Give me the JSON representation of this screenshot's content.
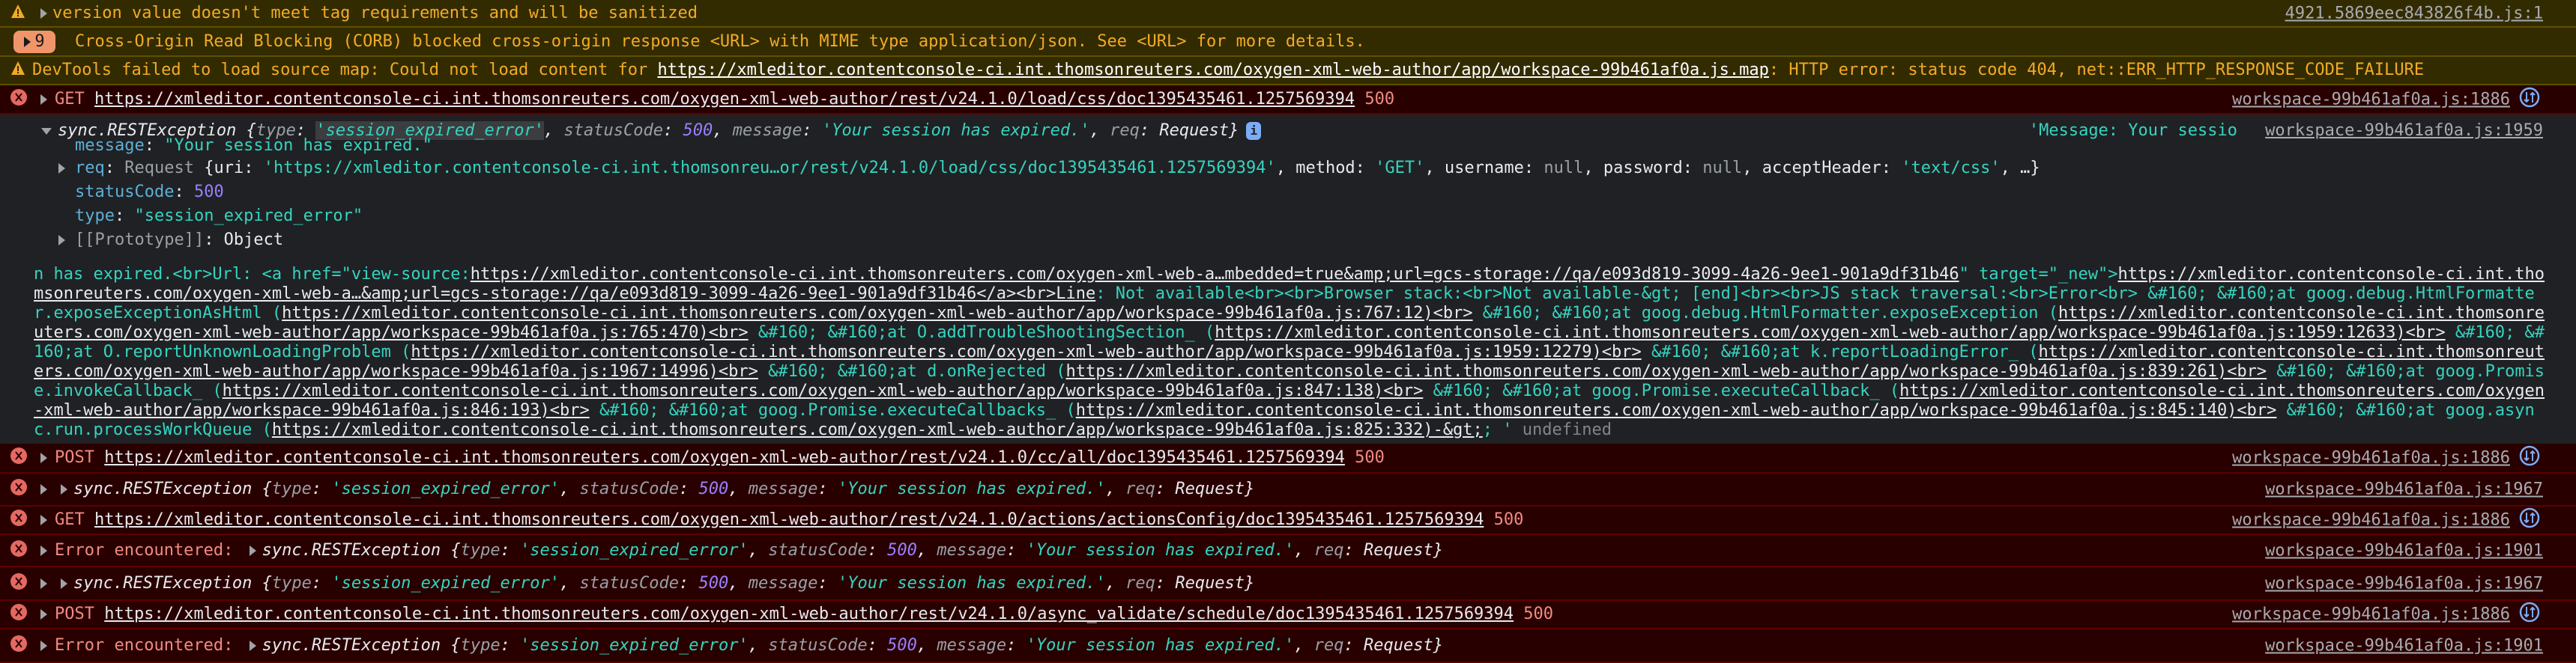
{
  "colors": {
    "warning_bg": "#332b00",
    "warning_text": "#f2ab26",
    "error_bg": "#290000",
    "error_text": "#f28b82",
    "string": "#35d4c0",
    "number": "#9980ff",
    "network_icon": "#7cacf8"
  },
  "rows_top": [
    {
      "level": "warning",
      "icon": "warning-icon",
      "has_toggle": true,
      "segments": [
        {
          "t": "version value doesn't meet tag requirements and will be sanitized"
        }
      ],
      "source": "4921.5869eec843826f4b.js:1"
    },
    {
      "level": "group",
      "count": "9",
      "segments": [
        {
          "t": "Cross-Origin Read Blocking (CORB) blocked cross-origin response <URL> with MIME type application/json. See <URL> for more details."
        }
      ]
    },
    {
      "level": "warning",
      "icon": "warning-icon",
      "has_toggle": false,
      "segments": [
        {
          "t": "DevTools failed to load source map: Could not load content for "
        },
        {
          "t": "https://xmleditor.contentconsole-ci.int.thomsonreuters.com/oxygen-xml-web-author/app/workspace-99b461af0a.js.map",
          "c": "link"
        },
        {
          "t": ": HTTP error: status code 404, net::ERR_HTTP_RESPONSE_CODE_FAILURE"
        }
      ]
    },
    {
      "level": "error",
      "icon": "error-icon",
      "has_toggle": true,
      "segments": [
        {
          "t": "GET",
          "c": "method"
        },
        {
          "t": " "
        },
        {
          "t": "https://xmleditor.contentconsole-ci.int.thomsonreuters.com/oxygen-xml-web-author/rest/v24.1.0/load/css/doc1395435461.1257569394",
          "c": "link"
        },
        {
          "t": " "
        },
        {
          "t": "500",
          "c": "status"
        }
      ],
      "source": "workspace-99b461af0a.js:1886",
      "network_icon": true
    }
  ],
  "expanded": {
    "header": [
      {
        "t": "sync.RESTException {",
        "c": "obj"
      },
      {
        "t": "type",
        "c": "key"
      },
      {
        "t": ": ",
        "c": "punct"
      },
      {
        "t": "'session_expired_error'",
        "c": "hl"
      },
      {
        "t": ", ",
        "c": "punct"
      },
      {
        "t": "statusCode",
        "c": "key"
      },
      {
        "t": ": ",
        "c": "punct"
      },
      {
        "t": "500",
        "c": "num"
      },
      {
        "t": ", ",
        "c": "punct"
      },
      {
        "t": "message",
        "c": "key"
      },
      {
        "t": ": ",
        "c": "punct"
      },
      {
        "t": "'Your session has expired.'",
        "c": "str"
      },
      {
        "t": ", ",
        "c": "punct"
      },
      {
        "t": "req",
        "c": "key"
      },
      {
        "t": ": ",
        "c": "punct"
      },
      {
        "t": "Request}",
        "c": "obj"
      }
    ],
    "info_icon": "i",
    "trailing": "'Message: Your sessio",
    "source": "workspace-99b461af0a.js:1959",
    "props": [
      {
        "toggle": false,
        "segments": [
          {
            "t": "message",
            "c": "pkey"
          },
          {
            "t": ": ",
            "c": "pplain"
          },
          {
            "t": "\"Your session has expired.\"",
            "c": "pstr"
          }
        ]
      },
      {
        "toggle": true,
        "segments": [
          {
            "t": "req",
            "c": "pkey"
          },
          {
            "t": ": ",
            "c": "pplain"
          },
          {
            "t": "Request ",
            "c": "pdim"
          },
          {
            "t": "{uri: ",
            "c": "pplain"
          },
          {
            "t": "'https://xmleditor.contentconsole-ci.int.thomsonreu…or/rest/v24.1.0/load/css/doc1395435461.1257569394'",
            "c": "pstr"
          },
          {
            "t": ", method: ",
            "c": "pplain"
          },
          {
            "t": "'GET'",
            "c": "pstr"
          },
          {
            "t": ", username: ",
            "c": "pplain"
          },
          {
            "t": "null",
            "c": "pdim"
          },
          {
            "t": ", password: ",
            "c": "pplain"
          },
          {
            "t": "null",
            "c": "pdim"
          },
          {
            "t": ", acceptHeader: ",
            "c": "pplain"
          },
          {
            "t": "'text/css'",
            "c": "pstr"
          },
          {
            "t": ", …}",
            "c": "pplain"
          }
        ]
      },
      {
        "toggle": false,
        "segments": [
          {
            "t": "statusCode",
            "c": "pkey"
          },
          {
            "t": ": ",
            "c": "pplain"
          },
          {
            "t": "500",
            "c": "pnum"
          }
        ]
      },
      {
        "toggle": false,
        "segments": [
          {
            "t": "type",
            "c": "pkey"
          },
          {
            "t": ": ",
            "c": "pplain"
          },
          {
            "t": "\"session_expired_error\"",
            "c": "pstr"
          }
        ]
      },
      {
        "toggle": true,
        "segments": [
          {
            "t": "[[Prototype]]",
            "c": "pdim"
          },
          {
            "t": ": Object",
            "c": "pplain"
          }
        ]
      }
    ]
  },
  "long_text": [
    [
      {
        "t": "n has expired.<br>Url: <a href=\"view-source:"
      },
      {
        "t": "https://xmleditor.contentconsole-ci.int.thomsonreuters.com/oxygen-xml-web-a…mbedded=true&amp;url=gcs-storage://qa/e093d819-3099-4a26-9ee1-901a9df31b46",
        "c": "link"
      },
      {
        "t": "\" target=\"_new\">"
      },
      {
        "t": "https://xmleditor.contentconsole-ci.int.tho",
        "c": "link"
      }
    ],
    [
      {
        "t": "msonreuters.com/oxygen-xml-web-a…&amp;url=gcs-storage://qa/e093d819-3099-4a26-9ee1-901a9df31b46</a><br>Line",
        "c": "link"
      },
      {
        "t": ": Not available<br><br>Browser stack:<br>Not available-&gt; [end]<br><br>JS stack traversal:<br>Error<br> &#160; &#160;at goog.debug.HtmlFormatte"
      }
    ],
    [
      {
        "t": "r.exposeExceptionAsHtml ("
      },
      {
        "t": "https://xmleditor.contentconsole-ci.int.thomsonreuters.com/oxygen-xml-web-author/app/workspace-99b461af0a.js:767:12)<br>",
        "c": "link"
      },
      {
        "t": " &#160; &#160;at goog.debug.HtmlFormatter.exposeException ("
      },
      {
        "t": "https://xmleditor.contentconsole-ci.int.thomsonre",
        "c": "link"
      }
    ],
    [
      {
        "t": "uters.com/oxygen-xml-web-author/app/workspace-99b461af0a.js:765:470)<br>",
        "c": "link"
      },
      {
        "t": " &#160; &#160;at O.addTroubleShootingSection_ ("
      },
      {
        "t": "https://xmleditor.contentconsole-ci.int.thomsonreuters.com/oxygen-xml-web-author/app/workspace-99b461af0a.js:1959:12633)<br>",
        "c": "link"
      },
      {
        "t": " &#160; &#"
      }
    ],
    [
      {
        "t": "160;at O.reportUnknownLoadingProblem ("
      },
      {
        "t": "https://xmleditor.contentconsole-ci.int.thomsonreuters.com/oxygen-xml-web-author/app/workspace-99b461af0a.js:1959:12279)<br>",
        "c": "link"
      },
      {
        "t": " &#160; &#160;at k.reportLoadingError_ ("
      },
      {
        "t": "https://xmleditor.contentconsole-ci.int.thomsonreut",
        "c": "link"
      }
    ],
    [
      {
        "t": "ers.com/oxygen-xml-web-author/app/workspace-99b461af0a.js:1967:14996)<br>",
        "c": "link"
      },
      {
        "t": " &#160; &#160;at d.onRejected ("
      },
      {
        "t": "https://xmleditor.contentconsole-ci.int.thomsonreuters.com/oxygen-xml-web-author/app/workspace-99b461af0a.js:839:261)<br>",
        "c": "link"
      },
      {
        "t": " &#160; &#160;at goog.Promis"
      }
    ],
    [
      {
        "t": "e.invokeCallback_ ("
      },
      {
        "t": "https://xmleditor.contentconsole-ci.int.thomsonreuters.com/oxygen-xml-web-author/app/workspace-99b461af0a.js:847:138)<br>",
        "c": "link"
      },
      {
        "t": " &#160; &#160;at goog.Promise.executeCallback_ ("
      },
      {
        "t": "https://xmleditor.contentconsole-ci.int.thomsonreuters.com/oxygen",
        "c": "link"
      }
    ],
    [
      {
        "t": "-xml-web-author/app/workspace-99b461af0a.js:846:193)<br>",
        "c": "link"
      },
      {
        "t": " &#160; &#160;at goog.Promise.executeCallbacks_ ("
      },
      {
        "t": "https://xmleditor.contentconsole-ci.int.thomsonreuters.com/oxygen-xml-web-author/app/workspace-99b461af0a.js:845:140)<br>",
        "c": "link"
      },
      {
        "t": " &#160; &#160;at goog.asyn"
      }
    ],
    [
      {
        "t": "c.run.processWorkQueue ("
      },
      {
        "t": "https://xmleditor.contentconsole-ci.int.thomsonreuters.com/oxygen-xml-web-author/app/workspace-99b461af0a.js:825:332)-&gt;",
        "c": "link"
      },
      {
        "t": "; ' "
      },
      {
        "t": "undefined",
        "c": "dim"
      }
    ]
  ],
  "rows_bottom": [
    {
      "level": "error",
      "icon": "error-icon",
      "has_toggle": true,
      "segments": [
        {
          "t": "POST",
          "c": "method"
        },
        {
          "t": " "
        },
        {
          "t": "https://xmleditor.contentconsole-ci.int.thomsonreuters.com/oxygen-xml-web-author/rest/v24.1.0/cc/all/doc1395435461.1257569394",
          "c": "link"
        },
        {
          "t": " "
        },
        {
          "t": "500",
          "c": "status"
        }
      ],
      "source": "workspace-99b461af0a.js:1886",
      "network_icon": true
    },
    {
      "level": "error",
      "icon": "error-icon",
      "has_toggle": true,
      "segments": [
        {
          "c": "arrow"
        },
        {
          "t": "sync.RESTException {",
          "c": "obj"
        },
        {
          "t": "type",
          "c": "key"
        },
        {
          "t": ": ",
          "c": "punct"
        },
        {
          "t": "'session_expired_error'",
          "c": "str"
        },
        {
          "t": ", ",
          "c": "punct"
        },
        {
          "t": "statusCode",
          "c": "key"
        },
        {
          "t": ": ",
          "c": "punct"
        },
        {
          "t": "500",
          "c": "num"
        },
        {
          "t": ", ",
          "c": "punct"
        },
        {
          "t": "message",
          "c": "key"
        },
        {
          "t": ": ",
          "c": "punct"
        },
        {
          "t": "'Your session has expired.'",
          "c": "str"
        },
        {
          "t": ", ",
          "c": "punct"
        },
        {
          "t": "req",
          "c": "key"
        },
        {
          "t": ": ",
          "c": "punct"
        },
        {
          "t": "Request}",
          "c": "obj"
        }
      ],
      "source": "workspace-99b461af0a.js:1967"
    },
    {
      "level": "error",
      "icon": "error-icon",
      "has_toggle": true,
      "segments": [
        {
          "t": "GET",
          "c": "method"
        },
        {
          "t": " "
        },
        {
          "t": "https://xmleditor.contentconsole-ci.int.thomsonreuters.com/oxygen-xml-web-author/rest/v24.1.0/actions/actionsConfig/doc1395435461.1257569394",
          "c": "link"
        },
        {
          "t": " "
        },
        {
          "t": "500",
          "c": "status"
        }
      ],
      "source": "workspace-99b461af0a.js:1886",
      "network_icon": true
    },
    {
      "level": "error",
      "icon": "error-icon",
      "has_toggle": true,
      "segments": [
        {
          "t": "Error encountered: "
        },
        {
          "c": "arrow"
        },
        {
          "t": "sync.RESTException {",
          "c": "obj"
        },
        {
          "t": "type",
          "c": "key"
        },
        {
          "t": ": ",
          "c": "punct"
        },
        {
          "t": "'session_expired_error'",
          "c": "str"
        },
        {
          "t": ", ",
          "c": "punct"
        },
        {
          "t": "statusCode",
          "c": "key"
        },
        {
          "t": ": ",
          "c": "punct"
        },
        {
          "t": "500",
          "c": "num"
        },
        {
          "t": ", ",
          "c": "punct"
        },
        {
          "t": "message",
          "c": "key"
        },
        {
          "t": ": ",
          "c": "punct"
        },
        {
          "t": "'Your session has expired.'",
          "c": "str"
        },
        {
          "t": ", ",
          "c": "punct"
        },
        {
          "t": "req",
          "c": "key"
        },
        {
          "t": ": ",
          "c": "punct"
        },
        {
          "t": "Request}",
          "c": "obj"
        }
      ],
      "source": "workspace-99b461af0a.js:1901"
    },
    {
      "level": "error",
      "icon": "error-icon",
      "has_toggle": true,
      "segments": [
        {
          "c": "arrow"
        },
        {
          "t": "sync.RESTException {",
          "c": "obj"
        },
        {
          "t": "type",
          "c": "key"
        },
        {
          "t": ": ",
          "c": "punct"
        },
        {
          "t": "'session_expired_error'",
          "c": "str"
        },
        {
          "t": ", ",
          "c": "punct"
        },
        {
          "t": "statusCode",
          "c": "key"
        },
        {
          "t": ": ",
          "c": "punct"
        },
        {
          "t": "500",
          "c": "num"
        },
        {
          "t": ", ",
          "c": "punct"
        },
        {
          "t": "message",
          "c": "key"
        },
        {
          "t": ": ",
          "c": "punct"
        },
        {
          "t": "'Your session has expired.'",
          "c": "str"
        },
        {
          "t": ", ",
          "c": "punct"
        },
        {
          "t": "req",
          "c": "key"
        },
        {
          "t": ": ",
          "c": "punct"
        },
        {
          "t": "Request}",
          "c": "obj"
        }
      ],
      "source": "workspace-99b461af0a.js:1967"
    },
    {
      "level": "error",
      "icon": "error-icon",
      "has_toggle": true,
      "segments": [
        {
          "t": "POST",
          "c": "method"
        },
        {
          "t": " "
        },
        {
          "t": "https://xmleditor.contentconsole-ci.int.thomsonreuters.com/oxygen-xml-web-author/rest/v24.1.0/async_validate/schedule/doc1395435461.1257569394",
          "c": "link"
        },
        {
          "t": " "
        },
        {
          "t": "500",
          "c": "status"
        }
      ],
      "source": "workspace-99b461af0a.js:1886",
      "network_icon": true
    },
    {
      "level": "error",
      "icon": "error-icon",
      "has_toggle": true,
      "segments": [
        {
          "t": "Error encountered: "
        },
        {
          "c": "arrow"
        },
        {
          "t": "sync.RESTException {",
          "c": "obj"
        },
        {
          "t": "type",
          "c": "key"
        },
        {
          "t": ": ",
          "c": "punct"
        },
        {
          "t": "'session_expired_error'",
          "c": "str"
        },
        {
          "t": ", ",
          "c": "punct"
        },
        {
          "t": "statusCode",
          "c": "key"
        },
        {
          "t": ": ",
          "c": "punct"
        },
        {
          "t": "500",
          "c": "num"
        },
        {
          "t": ", ",
          "c": "punct"
        },
        {
          "t": "message",
          "c": "key"
        },
        {
          "t": ": ",
          "c": "punct"
        },
        {
          "t": "'Your session has expired.'",
          "c": "str"
        },
        {
          "t": ", ",
          "c": "punct"
        },
        {
          "t": "req",
          "c": "key"
        },
        {
          "t": ": ",
          "c": "punct"
        },
        {
          "t": "Request}",
          "c": "obj"
        }
      ],
      "source": "workspace-99b461af0a.js:1901"
    }
  ]
}
